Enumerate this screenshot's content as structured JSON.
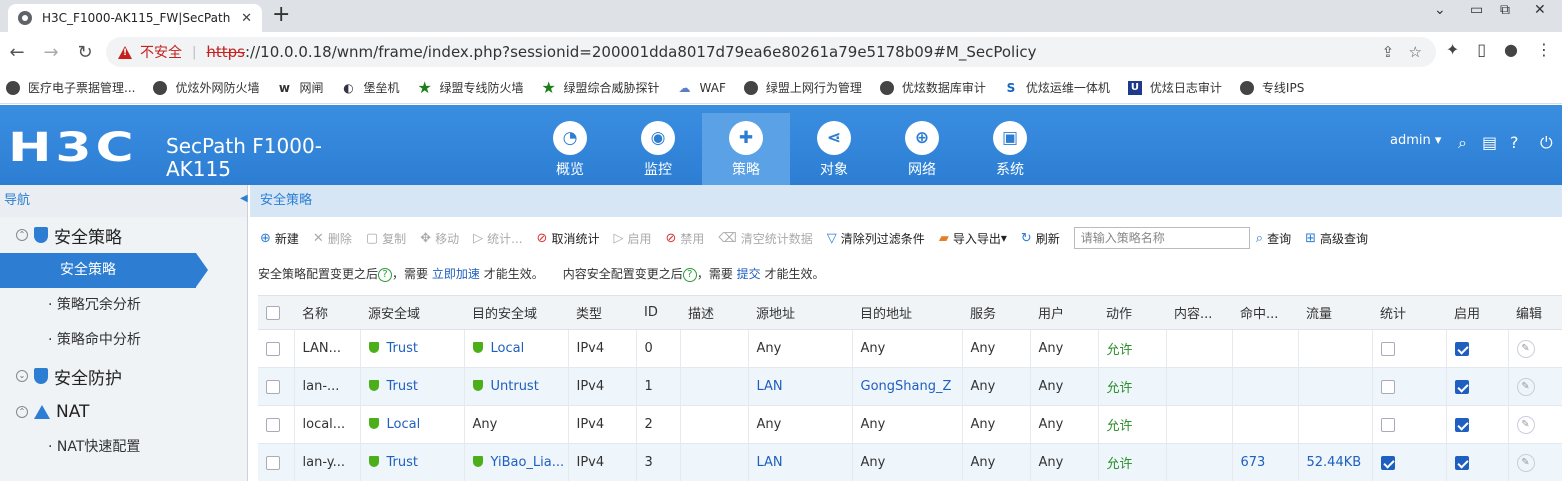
{
  "browser": {
    "tab_title": "H3C_F1000-AK115_FW|SecPath",
    "insecure_label": "不安全",
    "url_scheme": "https",
    "url_rest": "://10.0.0.18/wnm/frame/index.php?sessionid=200001dda8017d79ea6e80261a79e5178b09#M_SecPolicy",
    "bookmarks": [
      {
        "label": "医疗电子票据管理...",
        "icon": "globe-icon"
      },
      {
        "label": "优炫外网防火墙",
        "icon": "globe-icon"
      },
      {
        "label": "网闸",
        "icon": "w-icon"
      },
      {
        "label": "堡垒机",
        "icon": "shield-icon"
      },
      {
        "label": "绿盟专线防火墙",
        "icon": "star-icon"
      },
      {
        "label": "绿盟综合威胁探针",
        "icon": "star-icon"
      },
      {
        "label": "WAF",
        "icon": "cloud-icon"
      },
      {
        "label": "绿盟上网行为管理",
        "icon": "globe-icon"
      },
      {
        "label": "优炫数据库审计",
        "icon": "globe-icon"
      },
      {
        "label": "优炫运维一体机",
        "icon": "s-icon"
      },
      {
        "label": "优炫日志审计",
        "icon": "u-icon"
      },
      {
        "label": "专线IPS",
        "icon": "globe-icon"
      }
    ]
  },
  "app": {
    "logo": "H3C",
    "product_line1": "SecPath F1000-",
    "product_line2": "AK115",
    "nav": [
      {
        "label": "概览",
        "icon": "gauge-icon",
        "active": false
      },
      {
        "label": "监控",
        "icon": "monitor-icon",
        "active": false
      },
      {
        "label": "策略",
        "icon": "shield-icon",
        "active": true
      },
      {
        "label": "对象",
        "icon": "share-icon",
        "active": false
      },
      {
        "label": "网络",
        "icon": "globe-icon",
        "active": false
      },
      {
        "label": "系统",
        "icon": "screen-icon",
        "active": false
      }
    ],
    "user": "admin"
  },
  "sidebar": {
    "title": "导航",
    "group1": "安全策略",
    "item_active": "安全策略",
    "item2": "策略冗余分析",
    "item3": "策略命中分析",
    "group2": "安全防护",
    "group3": "NAT",
    "item4": "NAT快速配置"
  },
  "main": {
    "breadcrumb": "安全策略",
    "toolbar": {
      "new": "新建",
      "delete": "删除",
      "copy": "复制",
      "move": "移动",
      "stats": "统计...",
      "cancel_stats": "取消统计",
      "enable": "启用",
      "disable": "禁用",
      "clear_stats": "清空统计数据",
      "clear_filter": "清除列过滤条件",
      "import_export": "导入导出",
      "refresh": "刷新",
      "search_placeholder": "请输入策略名称",
      "search": "查询",
      "advanced_search": "高级查询"
    },
    "notice": {
      "part1": "安全策略配置变更之后",
      "part2": "，需要",
      "link1": "立即加速",
      "part3": "才能生效。",
      "part4": "内容安全配置变更之后",
      "part5": "，需要",
      "link2": "提交",
      "part6": "才能生效。"
    },
    "columns": [
      "名称",
      "源安全域",
      "目的安全域",
      "类型",
      "ID",
      "描述",
      "源地址",
      "目的地址",
      "服务",
      "用户",
      "动作",
      "内容...",
      "命中...",
      "流量",
      "统计",
      "启用",
      "编辑"
    ],
    "rows": [
      {
        "name": "LAN...",
        "src_zone": "Trust",
        "dst_zone": "Local",
        "type": "IPv4",
        "id": "0",
        "desc": "",
        "src_addr": "Any",
        "dst_addr": "Any",
        "service": "Any",
        "user": "Any",
        "action": "允许",
        "content": "",
        "hits": "",
        "traffic": "",
        "stat": false,
        "enabled": true
      },
      {
        "name": "lan-...",
        "src_zone": "Trust",
        "dst_zone": "Untrust",
        "type": "IPv4",
        "id": "1",
        "desc": "",
        "src_addr": "LAN",
        "dst_addr": "GongShang_Z",
        "service": "Any",
        "user": "Any",
        "action": "允许",
        "content": "",
        "hits": "",
        "traffic": "",
        "stat": false,
        "enabled": true
      },
      {
        "name": "local...",
        "src_zone": "Local",
        "dst_zone": "Any",
        "type": "IPv4",
        "id": "2",
        "desc": "",
        "src_addr": "Any",
        "dst_addr": "Any",
        "service": "Any",
        "user": "Any",
        "action": "允许",
        "content": "",
        "hits": "",
        "traffic": "",
        "stat": false,
        "enabled": true
      },
      {
        "name": "lan-y...",
        "src_zone": "Trust",
        "dst_zone": "YiBao_Lia...",
        "type": "IPv4",
        "id": "3",
        "desc": "",
        "src_addr": "LAN",
        "dst_addr": "Any",
        "service": "Any",
        "user": "Any",
        "action": "允许",
        "content": "",
        "hits": "673",
        "traffic": "52.44KB",
        "stat": true,
        "enabled": true
      }
    ]
  }
}
